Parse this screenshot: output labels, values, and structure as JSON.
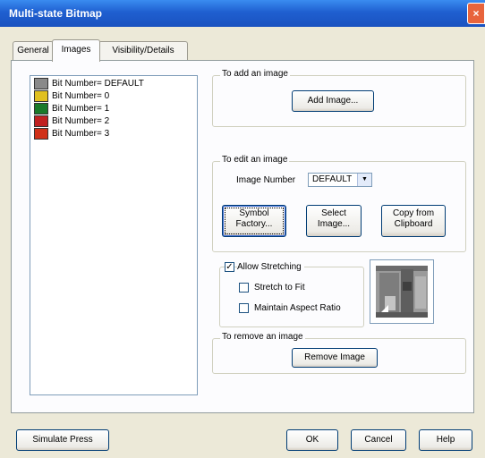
{
  "window": {
    "title": "Multi-state Bitmap",
    "close_label": "×"
  },
  "tabs": [
    {
      "label": "General"
    },
    {
      "label": "Images"
    },
    {
      "label": "Visibility/Details"
    }
  ],
  "list": {
    "items": [
      {
        "label": "Bit Number= DEFAULT",
        "color": "#8a8a8a"
      },
      {
        "label": "Bit Number= 0",
        "color": "#e0c020"
      },
      {
        "label": "Bit Number= 1",
        "color": "#1a7a2a"
      },
      {
        "label": "Bit Number= 2",
        "color": "#c02020"
      },
      {
        "label": "Bit Number= 3",
        "color": "#d03018"
      }
    ]
  },
  "add_group": {
    "label": "To add an image",
    "button": "Add Image..."
  },
  "edit_group": {
    "label": "To edit an image",
    "image_number_label": "Image Number",
    "image_number_value": "DEFAULT",
    "symbol_factory_1": "Symbol",
    "symbol_factory_2": "Factory...",
    "select_image_1": "Select",
    "select_image_2": "Image...",
    "copy_clipboard_1": "Copy from",
    "copy_clipboard_2": "Clipboard"
  },
  "stretch_group": {
    "allow_label": "Allow Stretching",
    "allow_checked": "✓",
    "stretch_to_fit_label": "Stretch to Fit",
    "maintain_aspect_label": "Maintain Aspect Ratio"
  },
  "remove_group": {
    "label": "To remove an image",
    "button": "Remove Image"
  },
  "footer": {
    "simulate": "Simulate Press",
    "ok": "OK",
    "cancel": "Cancel",
    "help": "Help"
  }
}
